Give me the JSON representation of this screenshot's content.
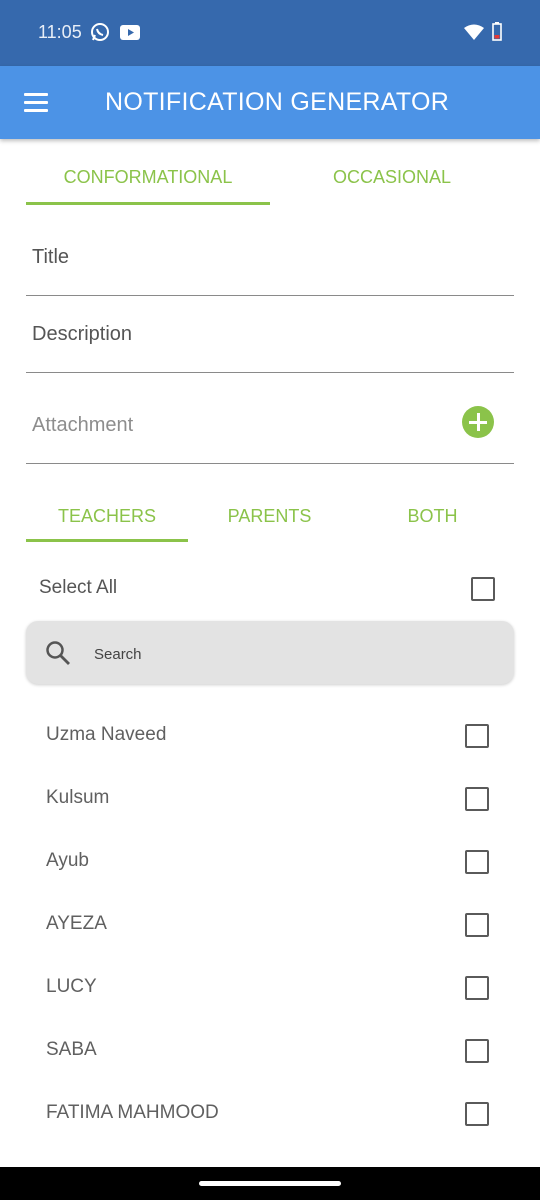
{
  "status_bar": {
    "time": "11:05",
    "icons": [
      "whatsapp-icon",
      "youtube-icon",
      "wifi-icon",
      "battery-low-icon"
    ]
  },
  "app_bar": {
    "title": "NOTIFICATION GENERATOR",
    "menu_icon": "hamburger-menu-icon"
  },
  "type_tabs": {
    "items": [
      "CONFORMATIONAL",
      "OCCASIONAL"
    ],
    "selected": "CONFORMATIONAL"
  },
  "form": {
    "title_label": "Title",
    "description_label": "Description",
    "attachment_label": "Attachment",
    "attachment_icon": "add-circle-icon"
  },
  "audience_tabs": {
    "items": [
      "TEACHERS",
      "PARENTS",
      "BOTH"
    ],
    "selected": "TEACHERS"
  },
  "select_all": {
    "label": "Select All",
    "checked": false
  },
  "search": {
    "placeholder": "Search",
    "icon": "search-icon"
  },
  "recipients": [
    {
      "name": "Uzma Naveed",
      "checked": false
    },
    {
      "name": "Kulsum",
      "checked": false
    },
    {
      "name": "Ayub",
      "checked": false
    },
    {
      "name": "AYEZA",
      "checked": false
    },
    {
      "name": "LUCY",
      "checked": false
    },
    {
      "name": "SABA",
      "checked": false
    },
    {
      "name": "FATIMA MAHMOOD",
      "checked": false
    }
  ],
  "colors": {
    "status_bar": "#3669ad",
    "app_bar": "#4c93e6",
    "accent": "#8bc34a"
  }
}
